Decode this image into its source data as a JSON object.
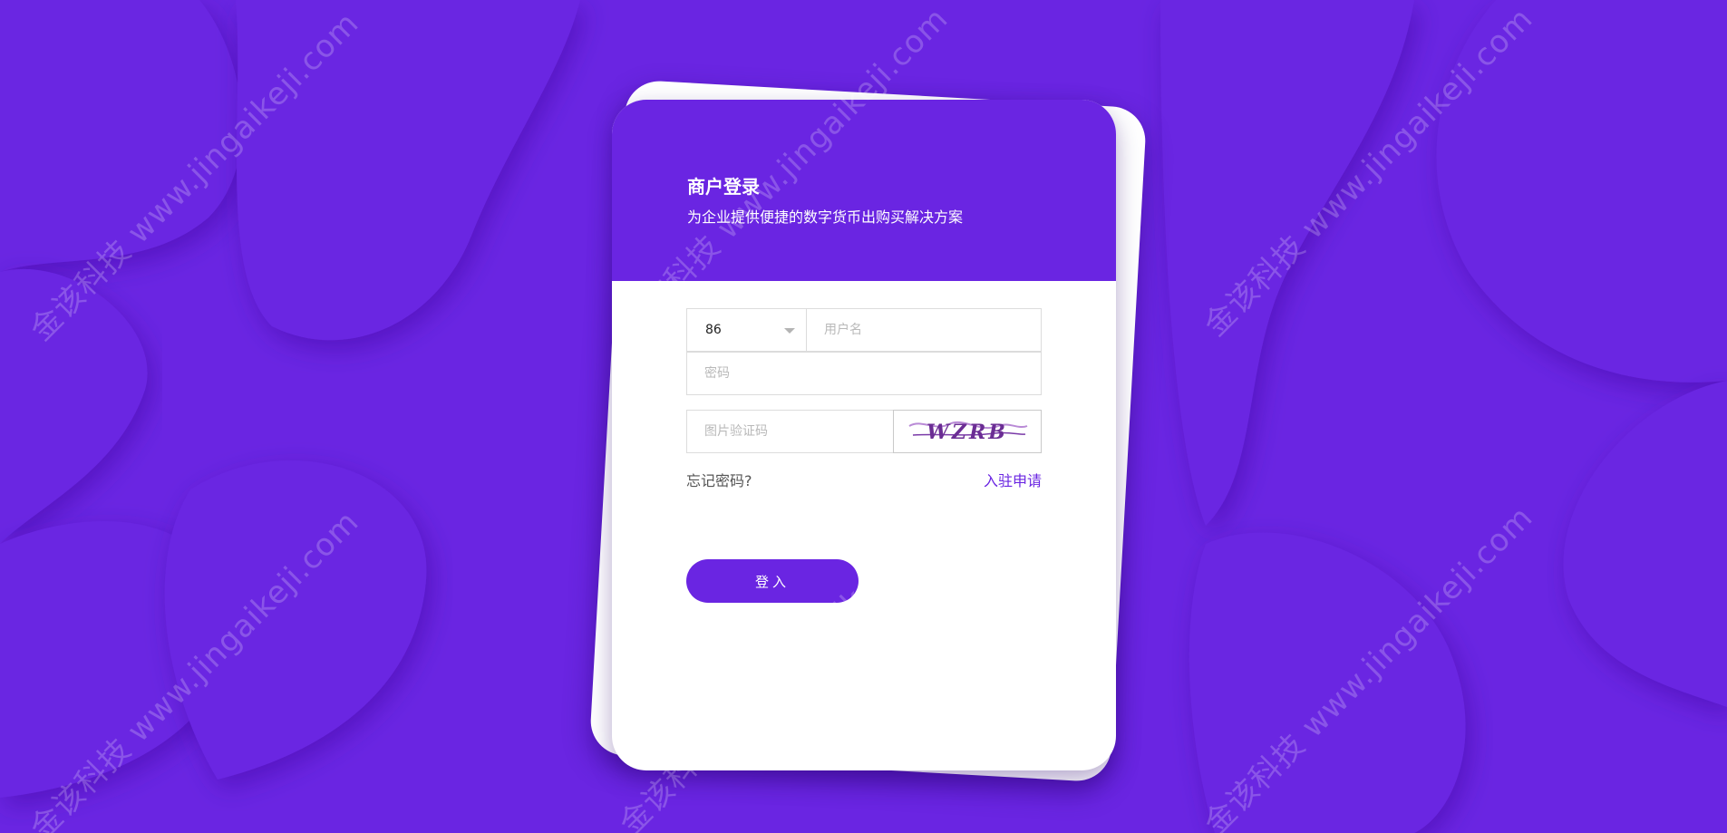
{
  "colors": {
    "brand": "#6a25e2",
    "background": "#6a25e2",
    "card": "#ffffff",
    "placeholder": "#b9b9b9"
  },
  "watermark_text": "金该科技 www.jingaikeji.com",
  "login": {
    "title": "商户登录",
    "subtitle": "为企业提供便捷的数字货币出购买解决方案",
    "country_code": "86",
    "username_placeholder": "用户名",
    "password_placeholder": "密码",
    "captcha_placeholder": "图片验证码",
    "captcha_code": "WZRB",
    "forgot_label": "忘记密码?",
    "apply_label": "入驻申请",
    "submit_label": "登入"
  }
}
